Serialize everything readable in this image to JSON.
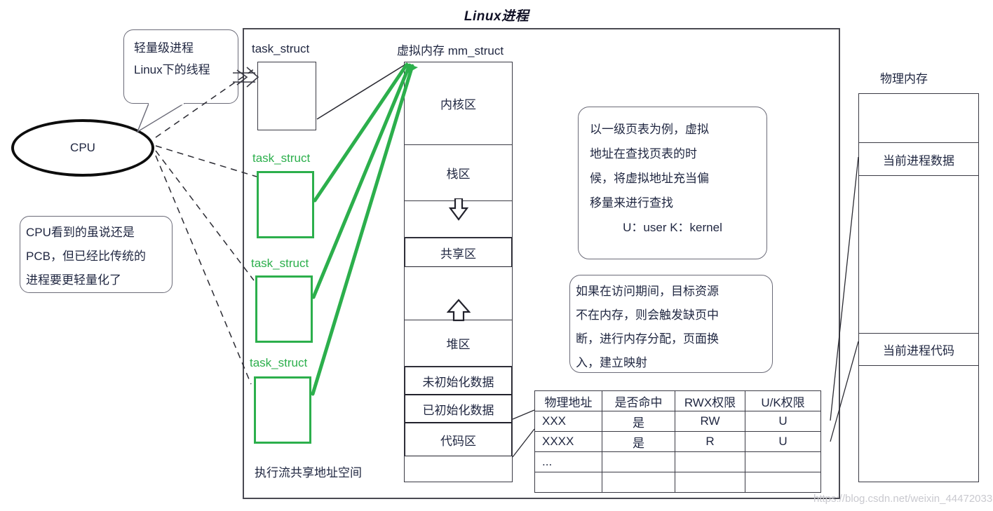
{
  "title": "Linux进程",
  "cpu": {
    "label": "CPU"
  },
  "callouts": {
    "thread": {
      "line1": "轻量级进程",
      "line2": "Linux下的线程"
    },
    "pcb": {
      "line1": "CPU看到的虽说还是",
      "line2": "PCB，但已经比传统的",
      "line3": "进程要更轻量化了"
    }
  },
  "task_structs": [
    {
      "label": "task_struct",
      "color": "#1f2640"
    },
    {
      "label": "task_struct",
      "color": "#2CAF4C"
    },
    {
      "label": "task_struct",
      "color": "#2CAF4C"
    },
    {
      "label": "task_struct",
      "color": "#2CAF4C"
    }
  ],
  "exec_flow_label": "执行流共享地址空间",
  "virtual_memory": {
    "title": "虚拟内存 mm_struct",
    "cells": [
      {
        "label": "内核区"
      },
      {
        "label": "栈区"
      },
      {
        "label": "",
        "icon": "arrow-down-icon"
      },
      {
        "label": "共享区"
      },
      {
        "label": "",
        "icon": "arrow-up-icon"
      },
      {
        "label": "堆区"
      },
      {
        "label": "未初始化数据"
      },
      {
        "label": "已初始化数据"
      },
      {
        "label": "代码区"
      },
      {
        "label": ""
      }
    ]
  },
  "info_boxes": {
    "paging": {
      "line1": "以一级页表为例，虚拟",
      "line2": "地址在查找页表的时",
      "line3": "候，将虚拟地址充当偏",
      "line4": "移量来进行查找",
      "line5": "U：user  K：kernel"
    },
    "page_fault": {
      "line1": "如果在访问期间，目标资源",
      "line2": "不在内存，则会触发缺页中",
      "line3": "断，进行内存分配，页面换",
      "line4": "入，建立映射"
    }
  },
  "page_table": {
    "headers": [
      "物理地址",
      "是否命中",
      "RWX权限",
      "U/K权限"
    ],
    "rows": [
      [
        "XXX",
        "是",
        "RW",
        "U"
      ],
      [
        "XXXX",
        "是",
        "R",
        "U"
      ],
      [
        "...",
        "",
        "",
        ""
      ],
      [
        "",
        "",
        "",
        ""
      ]
    ]
  },
  "physical_memory": {
    "title": "物理内存",
    "cells": [
      {
        "label": ""
      },
      {
        "label": "当前进程数据"
      },
      {
        "label": ""
      },
      {
        "label": "当前进程代码"
      },
      {
        "label": ""
      }
    ]
  },
  "watermark": "https://blog.csdn.net/weixin_44472033",
  "colors": {
    "green": "#2CAF4C",
    "outline": "#3a3a44",
    "text": "#1f2640"
  }
}
